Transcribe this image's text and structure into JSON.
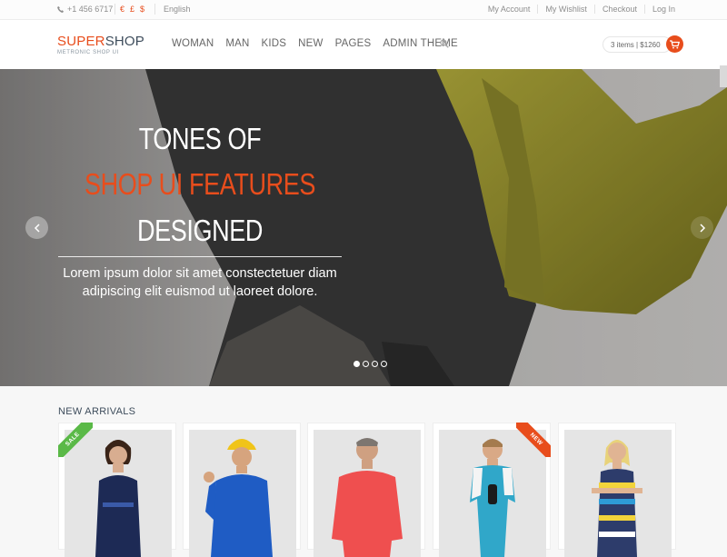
{
  "topbar": {
    "phone": "+1 456 6717",
    "currencies": [
      "€",
      "£",
      "$"
    ],
    "language": "English",
    "links": [
      "My Account",
      "My Wishlist",
      "Checkout",
      "Log In"
    ]
  },
  "header": {
    "logo_part1": "SUPER",
    "logo_part2": "SHOP",
    "logo_tagline": "METRONIC SHOP UI",
    "nav": [
      "WOMAN",
      "MAN",
      "KIDS",
      "NEW",
      "PAGES",
      "ADMIN THEME"
    ],
    "cart_label": "3 items | $1260"
  },
  "hero": {
    "line1": "TONES OF",
    "line2": "SHOP UI FEATURES",
    "line3": "DESIGNED",
    "subtitle": "Lorem ipsum dolor sit amet constectetuer diam adipiscing elit euismod ut laoreet dolore.",
    "slide_count": 4,
    "active_slide": 1
  },
  "arrivals": {
    "title": "NEW ARRIVALS",
    "badges": {
      "sale": "SALE",
      "new": "NEW"
    }
  },
  "colors": {
    "accent": "#e84d1c",
    "heading": "#3e4d5c",
    "sale_ribbon": "#5ab947"
  },
  "icons": {
    "phone": "phone-icon",
    "search": "search-icon",
    "cart": "cart-icon",
    "prev": "chevron-left-icon",
    "next": "chevron-right-icon"
  }
}
